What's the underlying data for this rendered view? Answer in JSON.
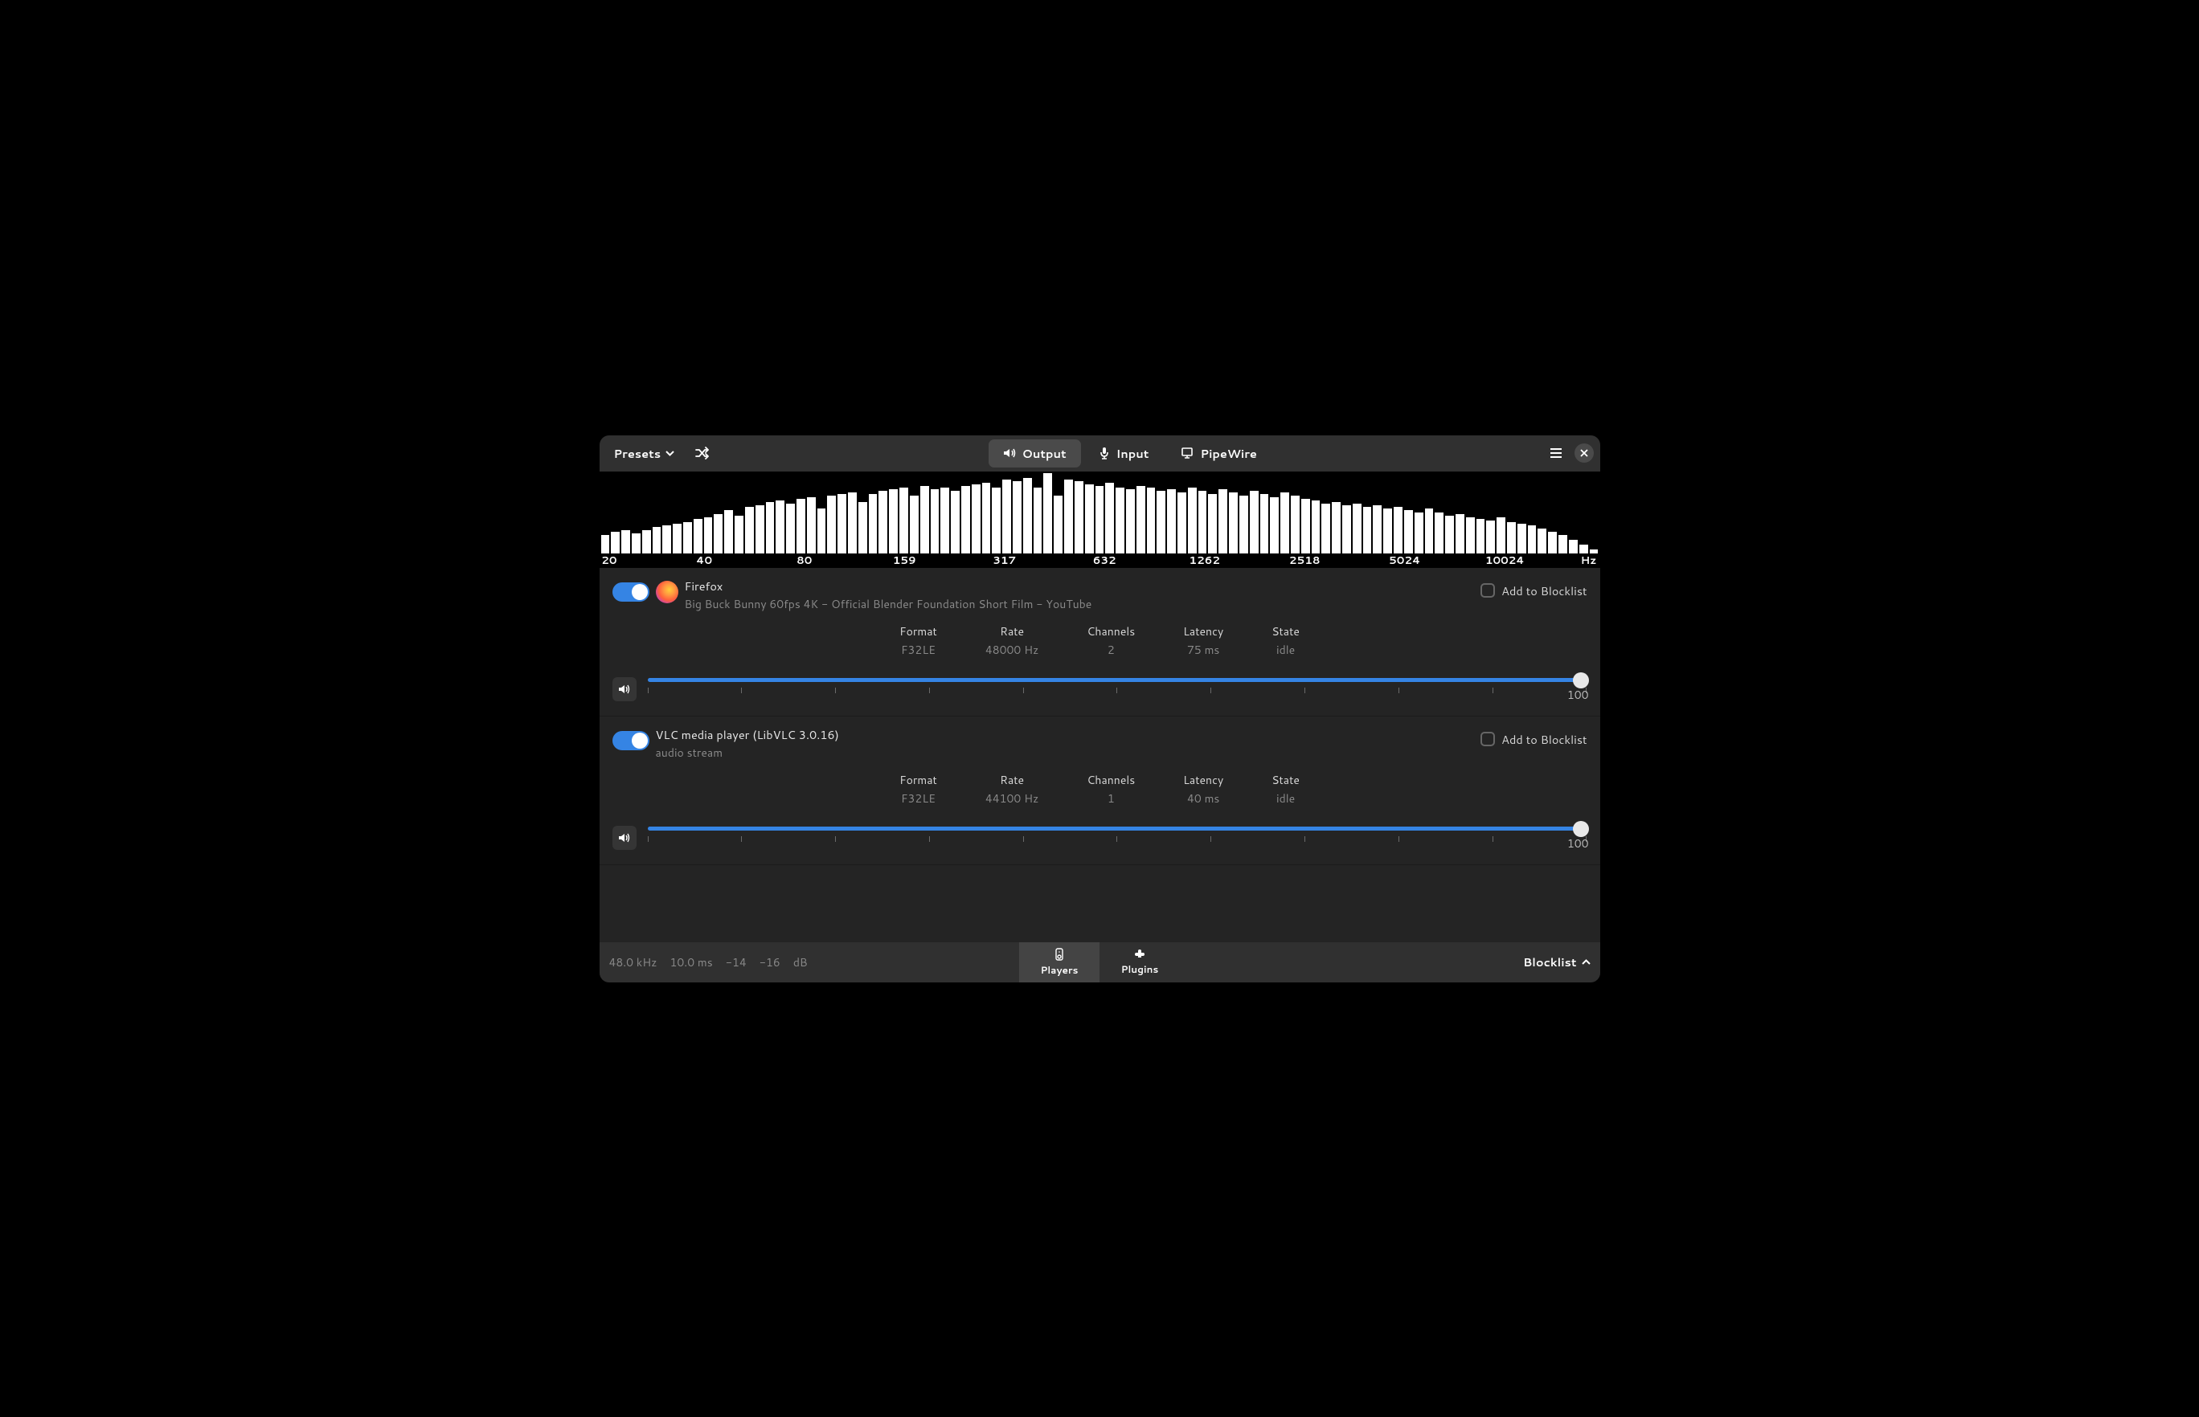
{
  "header": {
    "presets_label": "Presets",
    "tabs": {
      "output": "Output",
      "input": "Input",
      "pipewire": "PipeWire"
    }
  },
  "spectrum": {
    "freq_labels": [
      "20",
      "40",
      "80",
      "159",
      "317",
      "632",
      "1262",
      "2518",
      "5024",
      "10024"
    ],
    "hz_label": "Hz",
    "bars": [
      22,
      26,
      28,
      24,
      28,
      32,
      34,
      36,
      38,
      42,
      44,
      48,
      52,
      46,
      56,
      58,
      62,
      64,
      60,
      66,
      68,
      54,
      70,
      72,
      74,
      62,
      72,
      76,
      78,
      80,
      70,
      82,
      78,
      80,
      76,
      82,
      84,
      86,
      80,
      90,
      88,
      92,
      80,
      98,
      70,
      90,
      88,
      84,
      82,
      86,
      80,
      78,
      82,
      80,
      76,
      78,
      74,
      80,
      76,
      72,
      78,
      74,
      70,
      76,
      72,
      68,
      74,
      70,
      66,
      64,
      60,
      62,
      58,
      60,
      56,
      58,
      54,
      56,
      52,
      50,
      54,
      50,
      46,
      48,
      44,
      42,
      40,
      44,
      38,
      36,
      34,
      30,
      26,
      22,
      16,
      10,
      4
    ]
  },
  "labels": {
    "add_to_blocklist": "Add to Blocklist",
    "format": "Format",
    "rate": "Rate",
    "channels": "Channels",
    "latency": "Latency",
    "state": "State"
  },
  "players": [
    {
      "name": "Firefox",
      "subtitle": "Big Buck Bunny 60fps 4K - Official Blender Foundation Short Film - YouTube",
      "has_icon": true,
      "format": "F32LE",
      "rate": "48000 Hz",
      "channels": "2",
      "latency": "75 ms",
      "state": "idle",
      "volume": "100"
    },
    {
      "name": "VLC media player (LibVLC 3.0.16)",
      "subtitle": "audio stream",
      "has_icon": false,
      "format": "F32LE",
      "rate": "44100 Hz",
      "channels": "1",
      "latency": "40 ms",
      "state": "idle",
      "volume": "100"
    }
  ],
  "footer": {
    "sample_rate": "48.0 kHz",
    "buffer": "10.0 ms",
    "level_l": "-14",
    "level_r": "-16",
    "db": "dB",
    "players_label": "Players",
    "plugins_label": "Plugins",
    "blocklist_label": "Blocklist"
  }
}
